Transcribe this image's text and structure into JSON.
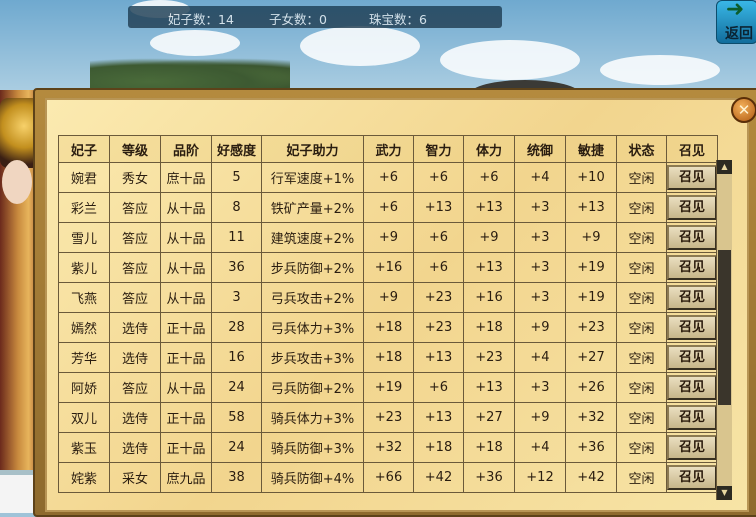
{
  "stats": {
    "concubine_count_label": "妃子数：",
    "concubine_count": "14",
    "children_count_label": "子女数：",
    "children_count": "0",
    "jewelry_count_label": "珠宝数：",
    "jewelry_count": "6"
  },
  "return_button": {
    "label": "返回",
    "icon": "return-arrow-icon"
  },
  "close_button": {
    "icon": "close-icon",
    "symbol": "✕"
  },
  "table": {
    "headers": [
      "妃子",
      "等级",
      "品阶",
      "好感度",
      "妃子助力",
      "武力",
      "智力",
      "体力",
      "统御",
      "敏捷",
      "状态",
      "召见"
    ],
    "summon_label": "召见",
    "rows": [
      {
        "name": "婉君",
        "level": "秀女",
        "grade": "庶十品",
        "favor": "5",
        "boost": "行军速度+1%",
        "force": "+6",
        "intel": "+6",
        "stamina": "+6",
        "command": "+4",
        "agility": "+10",
        "status": "空闲"
      },
      {
        "name": "彩兰",
        "level": "答应",
        "grade": "从十品",
        "favor": "8",
        "boost": "铁矿产量+2%",
        "force": "+6",
        "intel": "+13",
        "stamina": "+13",
        "command": "+3",
        "agility": "+13",
        "status": "空闲"
      },
      {
        "name": "雪儿",
        "level": "答应",
        "grade": "从十品",
        "favor": "11",
        "boost": "建筑速度+2%",
        "force": "+9",
        "intel": "+6",
        "stamina": "+9",
        "command": "+3",
        "agility": "+9",
        "status": "空闲"
      },
      {
        "name": "紫儿",
        "level": "答应",
        "grade": "从十品",
        "favor": "36",
        "boost": "步兵防御+2%",
        "force": "+16",
        "intel": "+6",
        "stamina": "+13",
        "command": "+3",
        "agility": "+19",
        "status": "空闲"
      },
      {
        "name": "飞燕",
        "level": "答应",
        "grade": "从十品",
        "favor": "3",
        "boost": "弓兵攻击+2%",
        "force": "+9",
        "intel": "+23",
        "stamina": "+16",
        "command": "+3",
        "agility": "+19",
        "status": "空闲"
      },
      {
        "name": "嫣然",
        "level": "选侍",
        "grade": "正十品",
        "favor": "28",
        "boost": "弓兵体力+3%",
        "force": "+18",
        "intel": "+23",
        "stamina": "+18",
        "command": "+9",
        "agility": "+23",
        "status": "空闲"
      },
      {
        "name": "芳华",
        "level": "选侍",
        "grade": "正十品",
        "favor": "16",
        "boost": "步兵攻击+3%",
        "force": "+18",
        "intel": "+13",
        "stamina": "+23",
        "command": "+4",
        "agility": "+27",
        "status": "空闲"
      },
      {
        "name": "阿娇",
        "level": "答应",
        "grade": "从十品",
        "favor": "24",
        "boost": "弓兵防御+2%",
        "force": "+19",
        "intel": "+6",
        "stamina": "+13",
        "command": "+3",
        "agility": "+26",
        "status": "空闲"
      },
      {
        "name": "双儿",
        "level": "选侍",
        "grade": "正十品",
        "favor": "58",
        "boost": "骑兵体力+3%",
        "force": "+23",
        "intel": "+13",
        "stamina": "+27",
        "command": "+9",
        "agility": "+32",
        "status": "空闲"
      },
      {
        "name": "紫玉",
        "level": "选侍",
        "grade": "正十品",
        "favor": "24",
        "boost": "骑兵防御+3%",
        "force": "+32",
        "intel": "+18",
        "stamina": "+18",
        "command": "+4",
        "agility": "+36",
        "status": "空闲"
      },
      {
        "name": "姹紫",
        "level": "采女",
        "grade": "庶九品",
        "favor": "38",
        "boost": "骑兵防御+4%",
        "force": "+66",
        "intel": "+42",
        "stamina": "+36",
        "command": "+12",
        "agility": "+42",
        "status": "空闲"
      }
    ]
  },
  "scrollbar": {
    "up_symbol": "▲",
    "down_symbol": "▼"
  },
  "colors": {
    "grade_text": "#1f3cc9",
    "parchment": "#f6e0a0",
    "frame": "#8e6a2d"
  }
}
